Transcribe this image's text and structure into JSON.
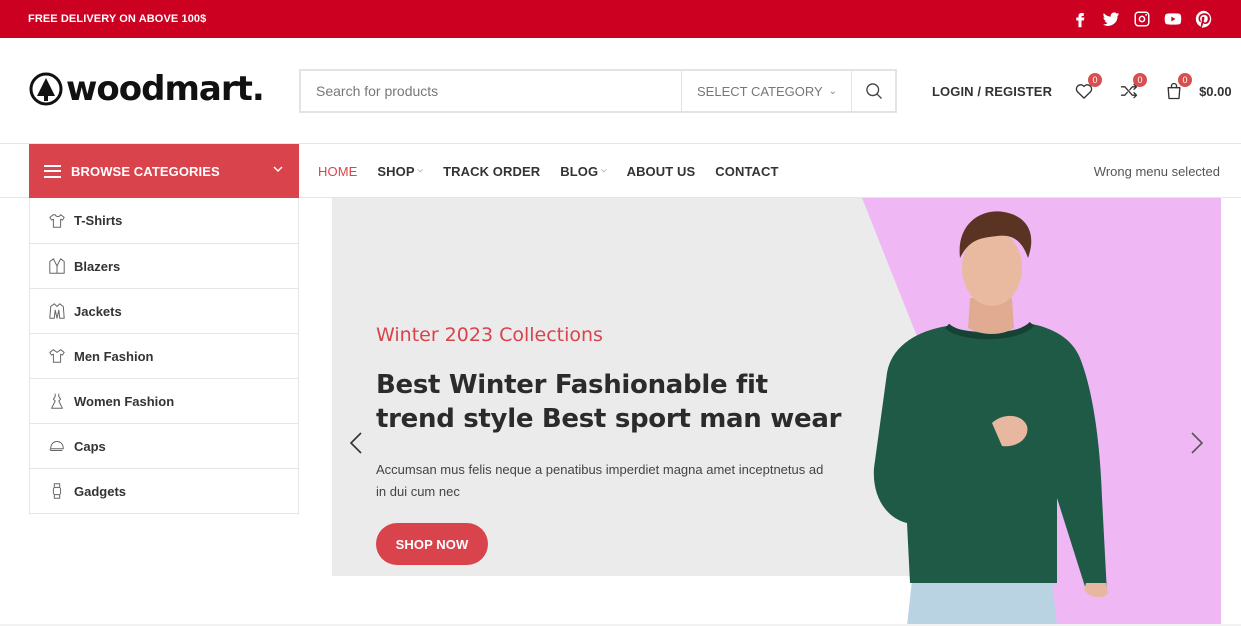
{
  "topbar": {
    "promo": "FREE DELIVERY ON ABOVE 100$",
    "socials": [
      "facebook-icon",
      "twitter-icon",
      "instagram-icon",
      "youtube-icon",
      "pinterest-icon"
    ],
    "bg_color": "#cc0021"
  },
  "header": {
    "logo_text": "woodmart.",
    "search": {
      "placeholder": "Search for products",
      "category": "SELECT CATEGORY"
    },
    "login_label": "LOGIN / REGISTER",
    "wishlist_count": "0",
    "compare_count": "0",
    "cart_count": "0",
    "cart_total": "$0.00"
  },
  "nav": {
    "browse_label": "BROWSE CATEGORIES",
    "menu": [
      {
        "label": "HOME",
        "active": true
      },
      {
        "label": "SHOP",
        "dropdown": true
      },
      {
        "label": "TRACK ORDER"
      },
      {
        "label": "BLOG",
        "dropdown": true
      },
      {
        "label": "ABOUT US"
      },
      {
        "label": "CONTACT"
      }
    ],
    "right_text": "Wrong menu selected"
  },
  "categories": [
    {
      "label": "T-Shirts",
      "icon": "tshirt-icon"
    },
    {
      "label": "Blazers",
      "icon": "blazer-icon"
    },
    {
      "label": "Jackets",
      "icon": "jacket-icon"
    },
    {
      "label": "Men Fashion",
      "icon": "men-shirt-icon"
    },
    {
      "label": "Women Fashion",
      "icon": "dress-icon"
    },
    {
      "label": "Caps",
      "icon": "cap-icon"
    },
    {
      "label": "Gadgets",
      "icon": "watch-icon"
    }
  ],
  "hero": {
    "subtitle": "Winter 2023 Collections",
    "title": "Best Winter Fashionable fit trend style Best sport man wear",
    "description": "Accumsan mus felis neque a penatibus imperdiet magna amet inceptnetus ad in dui cum nec",
    "button": "SHOP NOW",
    "accent_color": "#d9434b",
    "panel_color": "#ebebeb",
    "pink_color": "#efb8f5"
  }
}
